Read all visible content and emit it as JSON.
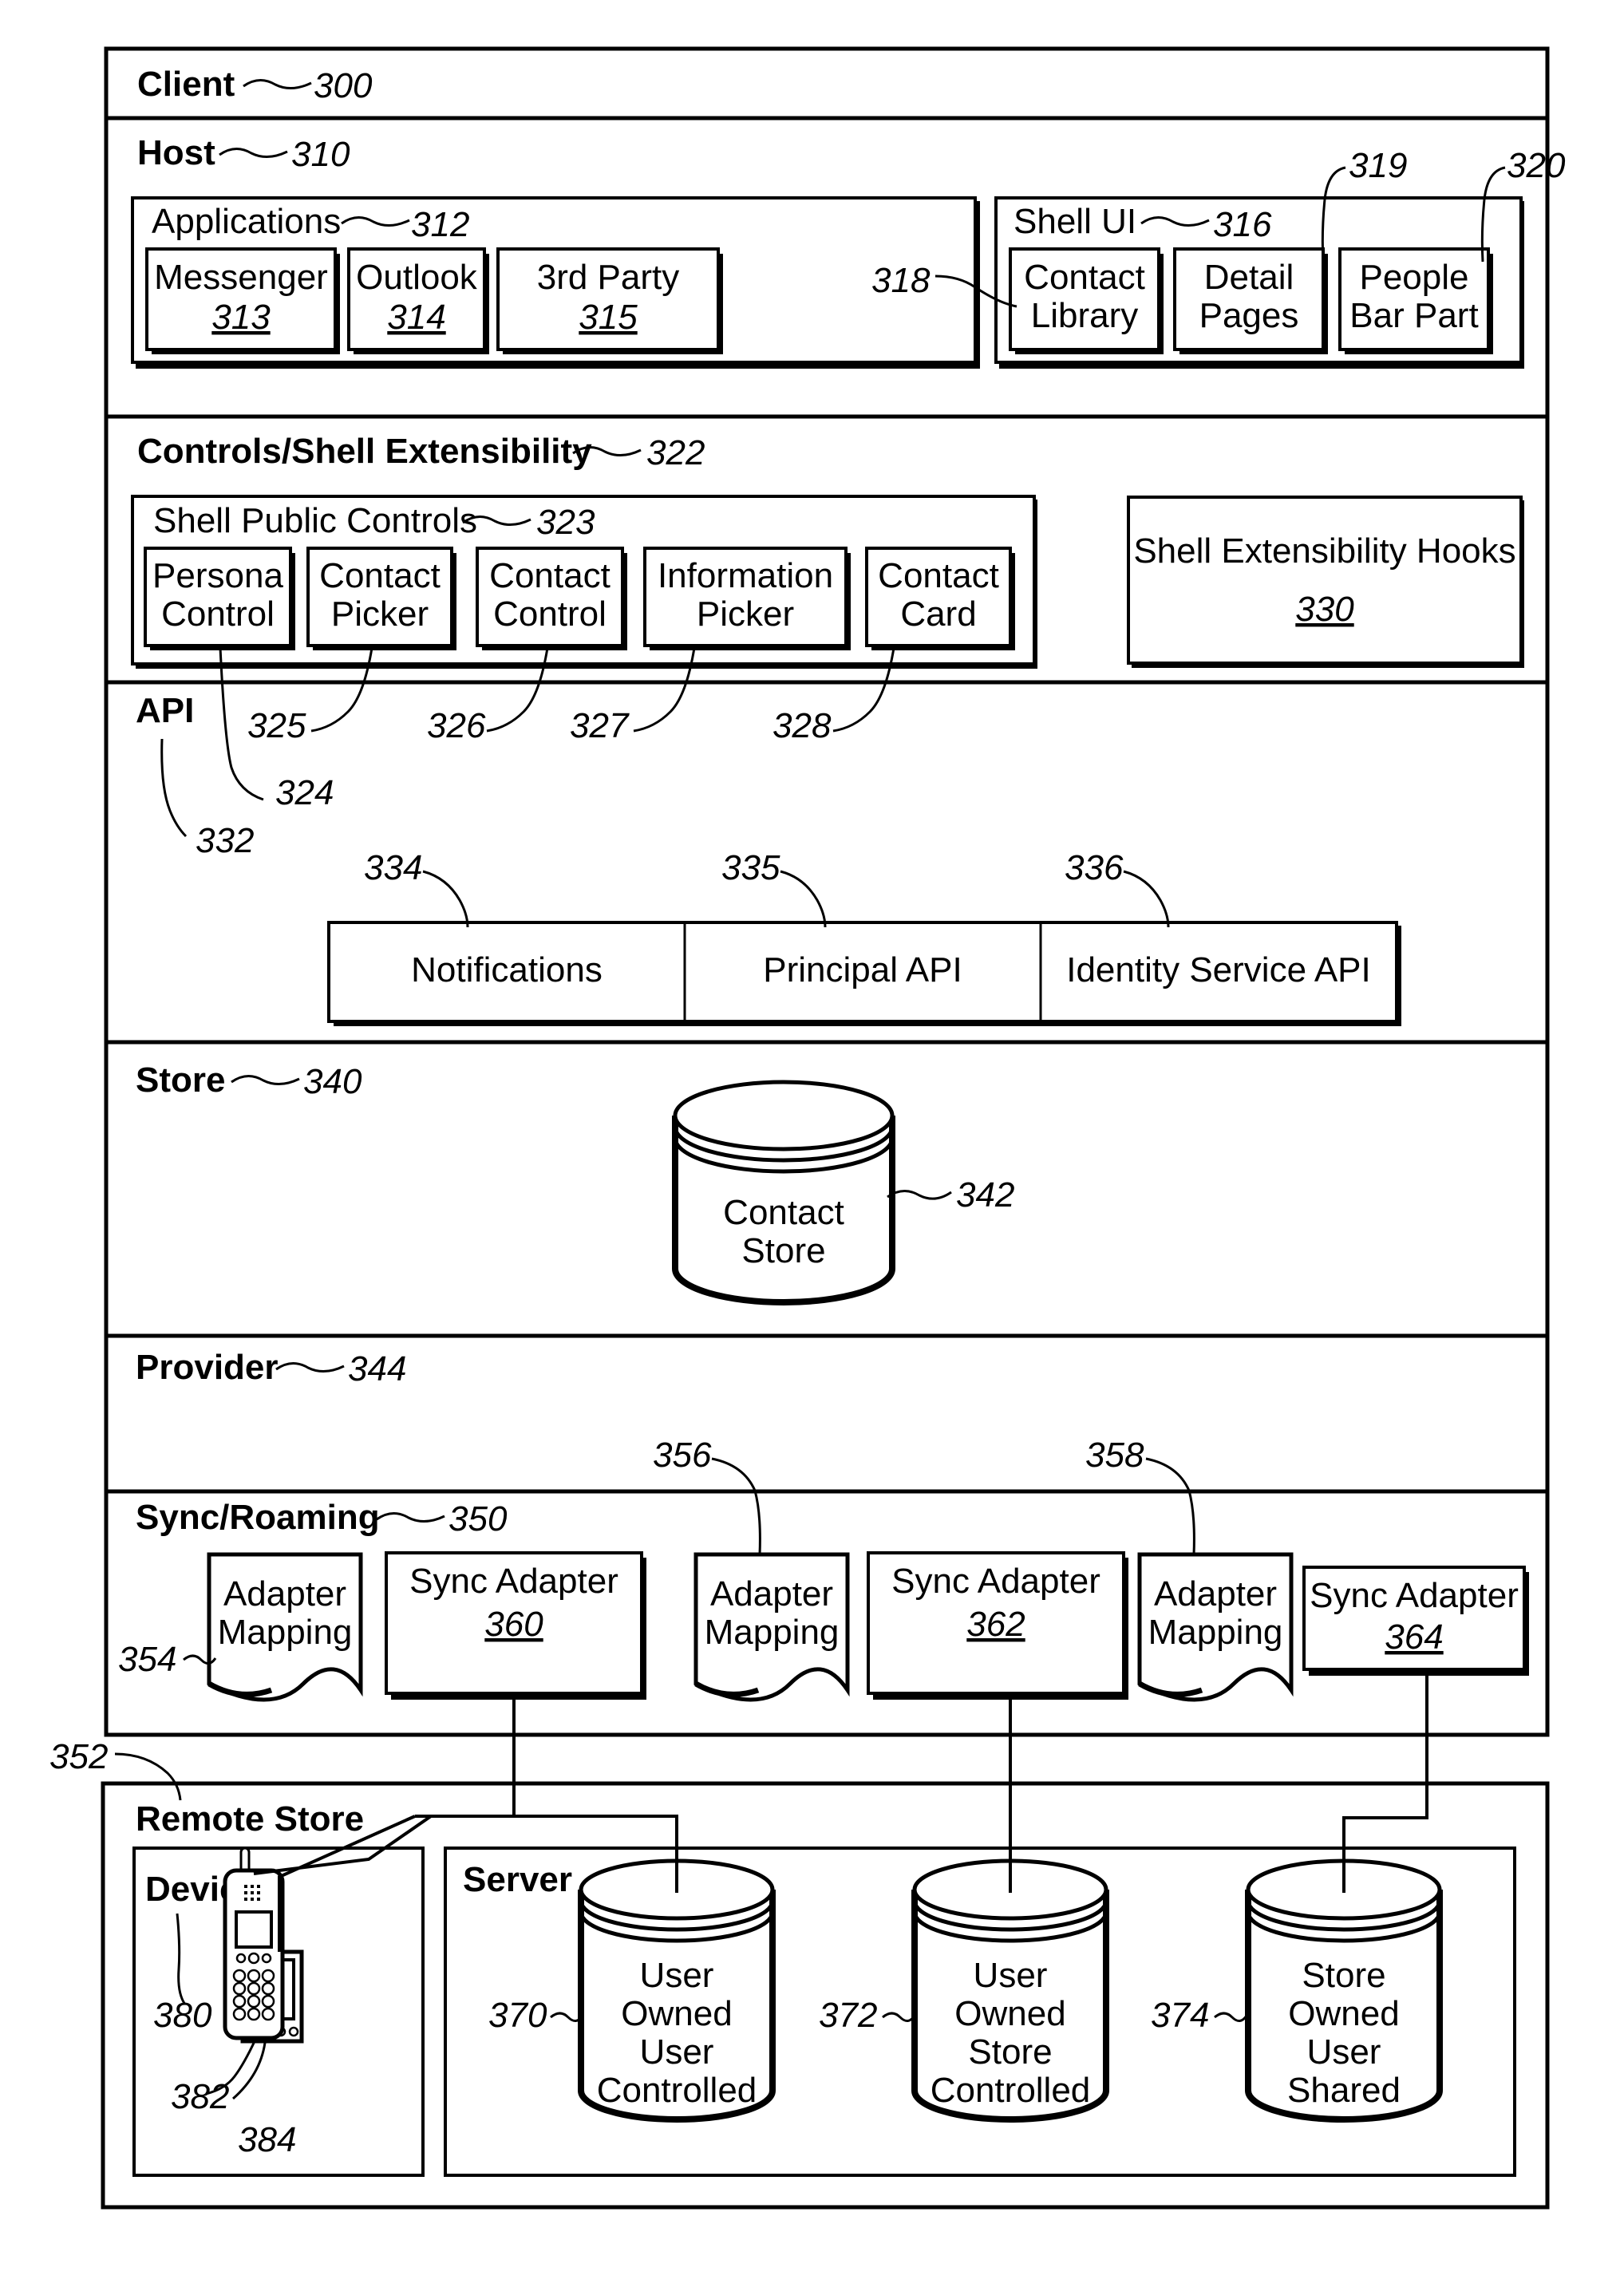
{
  "layers": {
    "client": {
      "label": "Client",
      "ref": "300"
    },
    "host": {
      "label": "Host",
      "ref": "310"
    },
    "controls": {
      "label": "Controls/Shell Extensibility",
      "ref": "322"
    },
    "api": {
      "label": "API",
      "ref": "332"
    },
    "store": {
      "label": "Store",
      "ref": "340"
    },
    "provider": {
      "label": "Provider",
      "ref": "344"
    },
    "sync": {
      "label": "Sync/Roaming",
      "ref": "350"
    },
    "remote": {
      "label": "Remote Store",
      "ref": "352"
    }
  },
  "host": {
    "applications": {
      "label": "Applications",
      "ref": "312",
      "items": [
        {
          "label": "Messenger",
          "ref": "313"
        },
        {
          "label": "Outlook",
          "ref": "314"
        },
        {
          "label": "3rd Party",
          "ref": "315"
        }
      ]
    },
    "shell_ui": {
      "label": "Shell UI",
      "ref": "316",
      "items": [
        {
          "line1": "Contact",
          "line2": "Library",
          "ref": "318"
        },
        {
          "line1": "Detail",
          "line2": "Pages",
          "ref": "319"
        },
        {
          "line1": "People",
          "line2": "Bar Part",
          "ref": "320"
        }
      ]
    }
  },
  "controls": {
    "public_controls": {
      "label": "Shell Public Controls",
      "ref": "323",
      "items": [
        {
          "line1": "Persona",
          "line2": "Control",
          "ref": "324"
        },
        {
          "line1": "Contact",
          "line2": "Picker",
          "ref": "325"
        },
        {
          "line1": "Contact",
          "line2": "Control",
          "ref": "326"
        },
        {
          "line1": "Information",
          "line2": "Picker",
          "ref": "327"
        },
        {
          "line1": "Contact",
          "line2": "Card",
          "ref": "328"
        }
      ]
    },
    "hooks": {
      "label": "Shell Extensibility Hooks",
      "ref": "330"
    }
  },
  "api": {
    "items": [
      {
        "label": "Notifications",
        "ref": "334"
      },
      {
        "label": "Principal API",
        "ref": "335"
      },
      {
        "label": "Identity Service API",
        "ref": "336"
      }
    ]
  },
  "store": {
    "contact_store": {
      "line1": "Contact",
      "line2": "Store",
      "ref": "342"
    }
  },
  "sync": {
    "mappings": [
      {
        "line1": "Adapter",
        "line2": "Mapping",
        "ref": "354"
      },
      {
        "line1": "Adapter",
        "line2": "Mapping",
        "ref": "356"
      },
      {
        "line1": "Adapter",
        "line2": "Mapping",
        "ref": "358"
      }
    ],
    "adapters": [
      {
        "label": "Sync Adapter",
        "ref": "360"
      },
      {
        "label": "Sync Adapter",
        "ref": "362"
      },
      {
        "label": "Sync Adapter",
        "ref": "364"
      }
    ]
  },
  "remote": {
    "devices": {
      "label": "Devices",
      "ref": "380",
      "pda_ref": "382",
      "phone_ref": "384"
    },
    "server": {
      "label": "Server",
      "stores": [
        {
          "lines": [
            "User",
            "Owned",
            "User",
            "Controlled"
          ],
          "ref": "370"
        },
        {
          "lines": [
            "User",
            "Owned",
            "Store",
            "Controlled"
          ],
          "ref": "372"
        },
        {
          "lines": [
            "Store",
            "Owned",
            "User",
            "Shared"
          ],
          "ref": "374"
        }
      ]
    }
  }
}
